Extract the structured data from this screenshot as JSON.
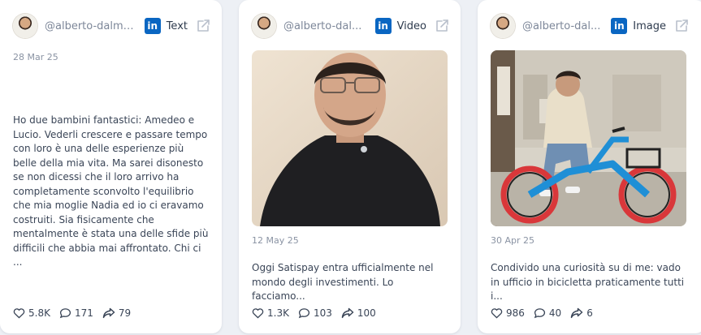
{
  "posts": [
    {
      "handle": "@alberto-dalma...",
      "platform": "linkedin",
      "type": "Text",
      "date": "28 Mar 25",
      "text": "Ho due bambini fantastici: Amedeo e Lucio. Vederli crescere e passare tempo con loro è una delle esperienze più belle della mia vita. Ma sarei disonesto se non dicessi che il loro arrivo ha completamente sconvolto l'equilibrio che mia moglie Nadia ed io ci eravamo costruiti. Sia fisicamente che mentalmente è stata una delle sfide più difficili che abbia mai affrontato. Chi ci ...",
      "likes": "5.8K",
      "comments": "171",
      "shares": "79"
    },
    {
      "handle": "@alberto-dal...",
      "platform": "linkedin",
      "type": "Video",
      "date": "12 May 25",
      "text": "Oggi Satispay entra ufficialmente nel mondo degli investimenti. Lo facciamo...",
      "likes": "1.3K",
      "comments": "103",
      "shares": "100"
    },
    {
      "handle": "@alberto-dal...",
      "platform": "linkedin",
      "type": "Image",
      "date": "30 Apr 25",
      "text": "Condivido una curiosità su di me: vado in ufficio in bicicletta praticamente tutti i...",
      "likes": "986",
      "comments": "40",
      "shares": "6"
    }
  ],
  "icons": {
    "linkedin_glyph": "in",
    "like": "heart-icon",
    "comment": "comment-icon",
    "share": "share-icon",
    "open": "external-link-icon"
  },
  "colors": {
    "linkedin": "#0a66c2",
    "muted": "#8a93a3"
  }
}
